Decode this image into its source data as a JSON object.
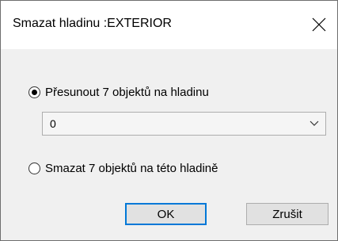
{
  "dialog": {
    "title": "Smazat hladinu :EXTERIOR",
    "close_icon": "close-icon"
  },
  "options": {
    "move": {
      "label": "Přesunout 7 objektů na hladinu",
      "checked": true
    },
    "delete": {
      "label": "Smazat 7 objektů na této hladině",
      "checked": false
    }
  },
  "layer_select": {
    "value": "0",
    "icon": "chevron-down-icon"
  },
  "buttons": {
    "ok": "OK",
    "cancel": "Zrušit"
  },
  "colors": {
    "default_button_border": "#0078d7",
    "dialog_background": "#f0f0f0"
  }
}
